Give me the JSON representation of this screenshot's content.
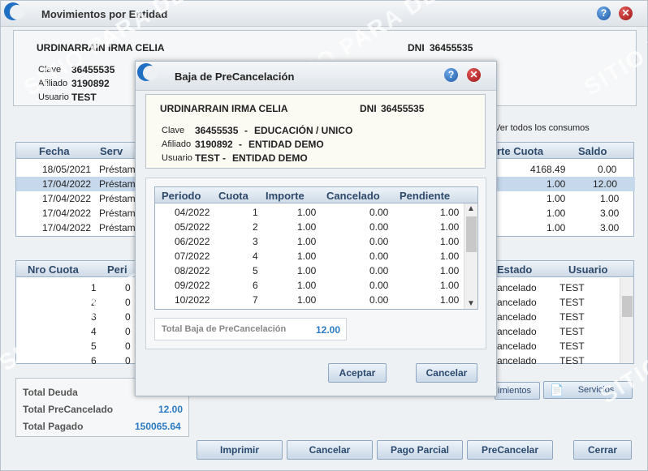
{
  "window": {
    "title": "Movimientos por Entidad",
    "help_label": "?",
    "close_label": "✕"
  },
  "person": {
    "name": "URDINARRAIN IRMA CELIA",
    "dni_label": "DNI",
    "dni": "36455535",
    "clave_label": "Clave",
    "clave": "36455535",
    "clave_desc": "EDUCACIÓN / UNICO",
    "afiliado_label": "Afiliado",
    "afiliado": "3190892",
    "afiliado_desc": "ENTIDAD DEMO",
    "usuario_label": "Usuario",
    "usuario": "TEST",
    "usuario_desc": "ENTIDAD DEMO",
    "dash": "-"
  },
  "background": {
    "ver_todos_label": "Ver todos los consumos",
    "grid1": {
      "headers": [
        "Fecha",
        "Serv",
        "rte Cuota",
        "Saldo"
      ],
      "rows": [
        {
          "fecha": "18/05/2021",
          "serv": "Préstam",
          "cuota": "4168.49",
          "saldo": "0.00"
        },
        {
          "fecha": "17/04/2022",
          "serv": "Préstam",
          "cuota": "1.00",
          "saldo": "12.00"
        },
        {
          "fecha": "17/04/2022",
          "serv": "Préstam",
          "cuota": "1.00",
          "saldo": "1.00"
        },
        {
          "fecha": "17/04/2022",
          "serv": "Préstam",
          "cuota": "1.00",
          "saldo": "3.00"
        },
        {
          "fecha": "17/04/2022",
          "serv": "Préstam",
          "cuota": "1.00",
          "saldo": "3.00"
        }
      ]
    },
    "grid2": {
      "headers": [
        "Nro Cuota",
        "Peri",
        "Estado",
        "Usuario"
      ],
      "rows": [
        {
          "nro": "1",
          "peri": "0",
          "estado": "ancelado",
          "usuario": "TEST"
        },
        {
          "nro": "2",
          "peri": "0",
          "estado": "ancelado",
          "usuario": "TEST"
        },
        {
          "nro": "3",
          "peri": "0",
          "estado": "ancelado",
          "usuario": "TEST"
        },
        {
          "nro": "4",
          "peri": "0",
          "estado": "ancelado",
          "usuario": "TEST"
        },
        {
          "nro": "5",
          "peri": "0",
          "estado": "ancelado",
          "usuario": "TEST"
        },
        {
          "nro": "6",
          "peri": "0",
          "estado": "ancelado",
          "usuario": "TEST"
        }
      ]
    },
    "totals": {
      "deuda_label": "Total Deuda",
      "precancelado_label": "Total PreCancelado",
      "precancelado": "12.00",
      "pagado_label": "Total Pagado",
      "pagado": "150065.64"
    },
    "mini_buttons": {
      "movimientos": "imientos",
      "servicios": "Servicios"
    },
    "buttons": {
      "imprimir": "Imprimir",
      "cancelar": "Cancelar",
      "pago_parcial": "Pago Parcial",
      "precancelar": "PreCancelar",
      "cerrar": "Cerrar"
    },
    "watermark": "SITIO PARA DEMO"
  },
  "modal": {
    "title": "Baja de PreCancelación",
    "grid": {
      "headers": [
        "Periodo",
        "Cuota",
        "Importe",
        "Cancelado",
        "Pendiente"
      ],
      "rows": [
        {
          "periodo": "04/2022",
          "cuota": "1",
          "importe": "1.00",
          "cancelado": "0.00",
          "pendiente": "1.00"
        },
        {
          "periodo": "05/2022",
          "cuota": "2",
          "importe": "1.00",
          "cancelado": "0.00",
          "pendiente": "1.00"
        },
        {
          "periodo": "06/2022",
          "cuota": "3",
          "importe": "1.00",
          "cancelado": "0.00",
          "pendiente": "1.00"
        },
        {
          "periodo": "07/2022",
          "cuota": "4",
          "importe": "1.00",
          "cancelado": "0.00",
          "pendiente": "1.00"
        },
        {
          "periodo": "08/2022",
          "cuota": "5",
          "importe": "1.00",
          "cancelado": "0.00",
          "pendiente": "1.00"
        },
        {
          "periodo": "09/2022",
          "cuota": "6",
          "importe": "1.00",
          "cancelado": "0.00",
          "pendiente": "1.00"
        },
        {
          "periodo": "10/2022",
          "cuota": "7",
          "importe": "1.00",
          "cancelado": "0.00",
          "pendiente": "1.00"
        }
      ]
    },
    "total_label": "Total Baja de PreCancelación",
    "total_value": "12.00",
    "aceptar_label": "Aceptar",
    "cancelar_label": "Cancelar"
  },
  "colors": {
    "accent": "#1f6fc2",
    "header_text": "#2d4a6b",
    "selected_row": "#c6d8ec",
    "total_value": "#2a7ac4"
  }
}
